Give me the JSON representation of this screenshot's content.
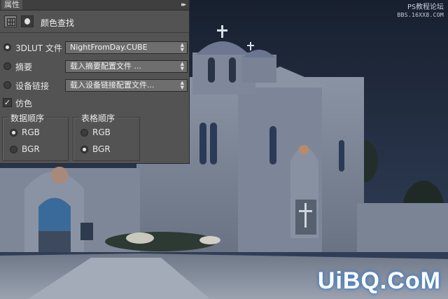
{
  "panel": {
    "tab_title": "属性",
    "menu_glyph": "▸▸",
    "header_title": "颜色查找"
  },
  "options": [
    {
      "label": "3DLUT 文件",
      "value": "NightFromDay.CUBE",
      "selected": true
    },
    {
      "label": "摘要",
      "value": "载入摘要配置文件 ...",
      "selected": false
    },
    {
      "label": "设备链接",
      "value": "载入设备链接配置文件...",
      "selected": false
    }
  ],
  "dither": {
    "label": "仿色",
    "checked": true,
    "mark": "✓"
  },
  "data_order": {
    "label": "数据顺序",
    "rgb": "RGB",
    "bgr": "BGR",
    "selected": "RGB"
  },
  "table_order": {
    "label": "表格顺序",
    "rgb": "RGB",
    "bgr": "BGR",
    "selected": "BGR"
  },
  "watermarks": {
    "top_line1": "PS教程论坛",
    "top_line2": "BBS.16XX8.COM",
    "bottom": "UiBQ.CoM"
  },
  "colors": {
    "sky_top": "#1a2233",
    "sky_bottom": "#2f3e58",
    "panel_bg": "#535353",
    "watermark_glow": "#4a90d9"
  }
}
